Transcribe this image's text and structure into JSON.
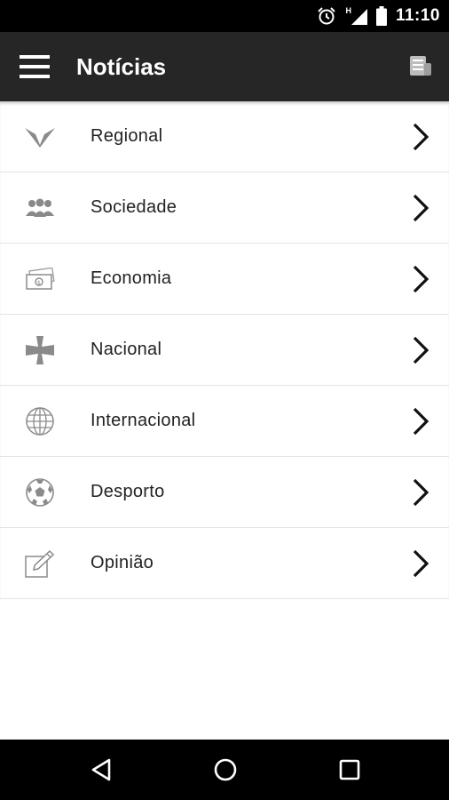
{
  "status_bar": {
    "time": "11:10",
    "network": "H"
  },
  "app_bar": {
    "title": "Notícias",
    "menu_icon": "hamburger-menu-icon",
    "action_icon": "newspaper-icon"
  },
  "items": [
    {
      "label": "Regional",
      "icon": "eagle-icon"
    },
    {
      "label": "Sociedade",
      "icon": "people-group-icon"
    },
    {
      "label": "Economia",
      "icon": "money-banknote-icon"
    },
    {
      "label": "Nacional",
      "icon": "cross-icon"
    },
    {
      "label": "Internacional",
      "icon": "globe-icon"
    },
    {
      "label": "Desporto",
      "icon": "soccer-ball-icon"
    },
    {
      "label": "Opinião",
      "icon": "pencil-paper-icon"
    }
  ],
  "nav_bar": {
    "back": "back-triangle-icon",
    "home": "home-circle-icon",
    "recents": "recents-square-icon"
  },
  "colors": {
    "app_bar": "#262626",
    "status_bar": "#000000",
    "icon_gray": "#8a8a8a",
    "divider": "#e4e4e4"
  }
}
